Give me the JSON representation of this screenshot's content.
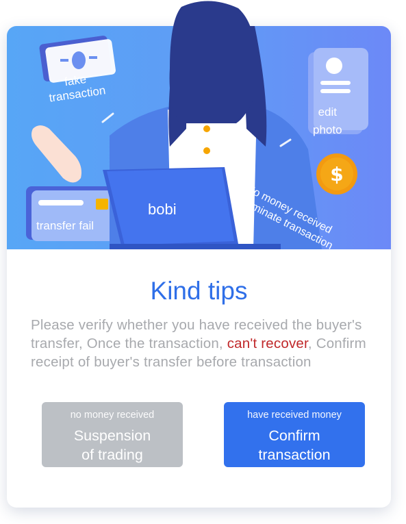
{
  "hero": {
    "fake_label_line1": "fake",
    "fake_label_line2": "transaction",
    "edit_label_line1": "edit",
    "edit_label_line2": "photo",
    "transfer_label": "transfer fail",
    "laptop_brand": "bobi",
    "nomoney_line1": "No money received",
    "nomoney_line2": "terminate transaction",
    "colors": {
      "gradient_start": "#57a6f6",
      "gradient_end": "#6c89f7"
    }
  },
  "dialog": {
    "title": "Kind tips",
    "desc_part1": "Please verify whether you have received the buyer's transfer,  Once the transaction, ",
    "desc_warning": "can't recover",
    "desc_part2": ",  Confirm receipt of buyer's transfer before transaction"
  },
  "buttons": {
    "suspend": {
      "sub": "no money received",
      "main_line1": "Suspension",
      "main_line2": "of trading"
    },
    "confirm": {
      "sub": "have received money",
      "main_line1": "Confirm",
      "main_line2": "transaction"
    }
  },
  "colors": {
    "title": "#2f6fe8",
    "warning": "#c0282a",
    "confirm_button": "#3271ed",
    "suspend_button": "#bcc0c5"
  }
}
